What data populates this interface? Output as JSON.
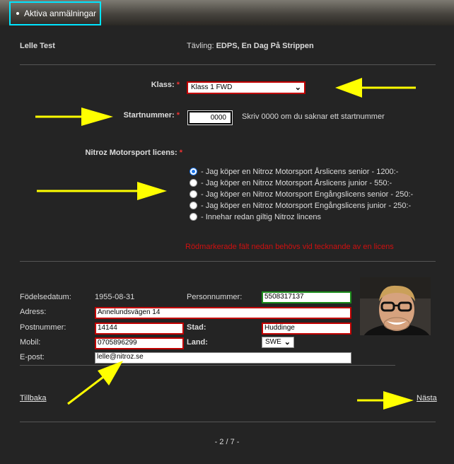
{
  "nav": {
    "active_label": "Aktiva anmälningar"
  },
  "header": {
    "name": "Lelle Test",
    "competition_label": "Tävling:",
    "competition_value": "EDPS, En Dag På Strippen"
  },
  "klass": {
    "label": "Klass:",
    "value": "Klass 1 FWD"
  },
  "startnummer": {
    "label": "Startnummer:",
    "value": "0000",
    "hint": "Skriv 0000 om du saknar ett startnummer"
  },
  "licens": {
    "label": "Nitroz Motorsport licens:",
    "options": [
      "- Jag köper en Nitroz Motorsport Årslicens senior - 1200:-",
      "- Jag köper en Nitroz Motorsport Årslicens junior - 550:-",
      "- Jag köper en Nitroz Motorsport Engångslicens senior - 250:-",
      "- Jag köper en Nitroz Motorsport Engångslicens junior - 250:-",
      "- Innehar redan giltig Nitroz lincens"
    ],
    "selected_index": 0,
    "notice": "Rödmarkerade fält nedan behövs vid tecknande av en licens"
  },
  "person": {
    "birth_label": "Födelsedatum:",
    "birth_value": "1955-08-31",
    "pnr_label": "Personnummer:",
    "pnr_value": "5508317137",
    "address_label": "Adress:",
    "address_value": "Annelundsvägen 14",
    "postal_label": "Postnummer:",
    "postal_value": "14144",
    "city_label": "Stad:",
    "city_value": "Huddinge",
    "mobile_label": "Mobil:",
    "mobile_value": "0705896299",
    "country_label": "Land:",
    "country_value": "SWE",
    "email_label": "E-post:",
    "email_value": "lelle@nitroz.se"
  },
  "footer": {
    "back_label": "Tillbaka",
    "next_label": "Nästa",
    "pager": "- 2 / 7 -"
  },
  "colors": {
    "accent_arrow": "#ffff00",
    "required": "#e33333",
    "invalid_border": "#c00000",
    "valid_border": "#1a8a1a",
    "highlight": "#00e5ff"
  }
}
